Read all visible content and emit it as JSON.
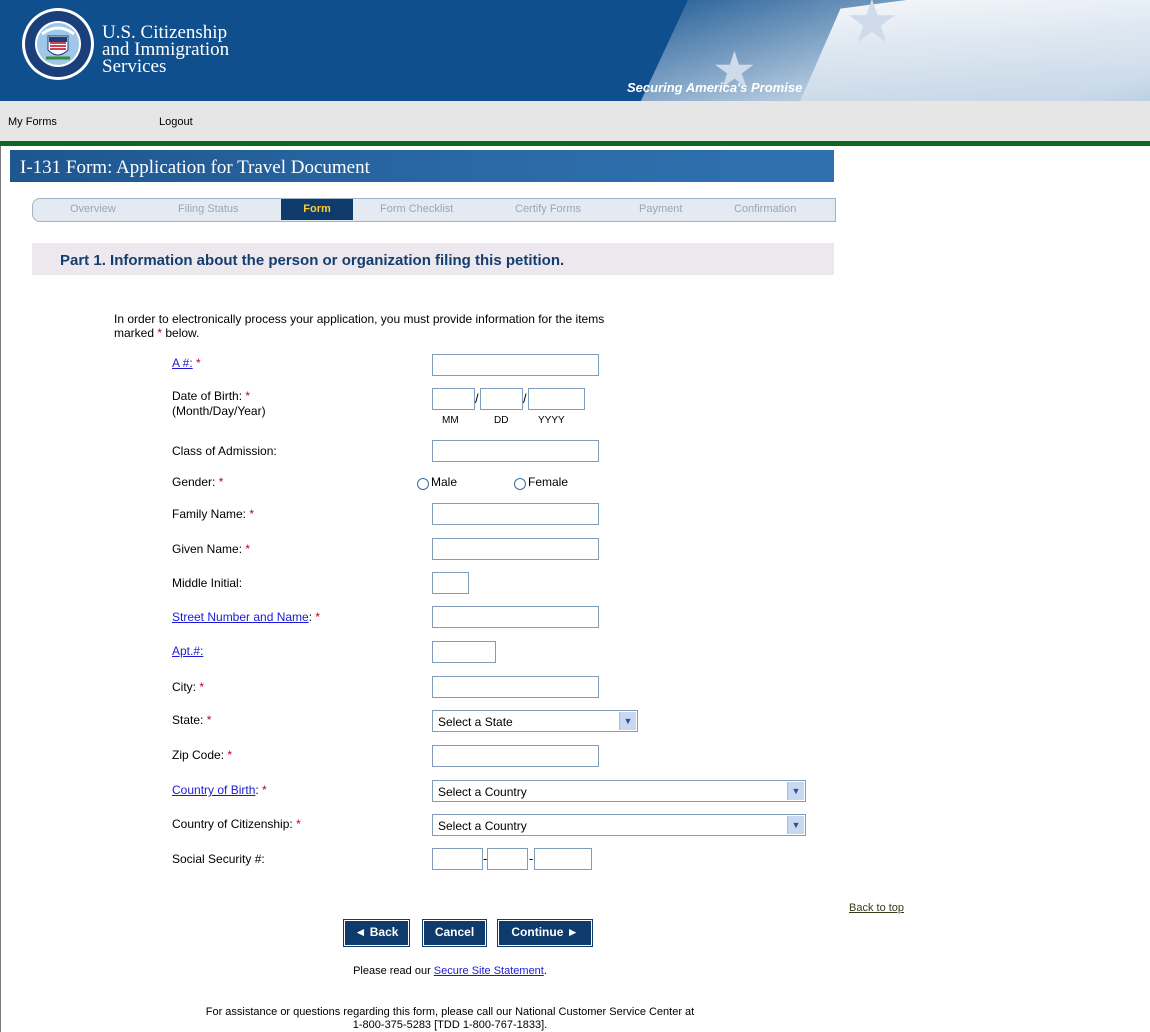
{
  "header": {
    "agency_line1": "U.S. Citizenship",
    "agency_line2": "and Immigration",
    "agency_line3": "Services",
    "tagline": "Securing America's Promise"
  },
  "nav": {
    "my_forms": "My Forms",
    "logout": "Logout"
  },
  "form": {
    "title": "I-131 Form: Application for Travel Document",
    "tabs": [
      "Overview",
      "Filing Status",
      "Form",
      "Form Checklist",
      "Certify Forms",
      "Payment",
      "Confirmation"
    ],
    "active_tab": "Form",
    "part_heading": "Part 1. Information about the person or organization filing this petition.",
    "intro_line1": "In order to electronically process your application, you must provide information for the items",
    "intro_line2_a": "marked ",
    "intro_line2_b": " below.",
    "required_marker": "*",
    "fields": {
      "a_number": "A #:",
      "dob": "Date of Birth:",
      "dob_hint": "(Month/Day/Year)",
      "dob_mm": "MM",
      "dob_dd": "DD",
      "dob_yyyy": "YYYY",
      "class_of_admission": "Class of Admission:",
      "gender": "Gender:",
      "gender_male": "Male",
      "gender_female": "Female",
      "family_name": "Family Name:",
      "given_name": "Given Name:",
      "middle_initial": "Middle Initial:",
      "street": "Street Number and Name",
      "apt": "Apt.#:",
      "city": "City:",
      "state": "State:",
      "state_value": "Select a State",
      "zip": "Zip Code:",
      "country_birth": "Country of Birth",
      "country_birth_value": "Select a Country",
      "country_citizenship": "Country of Citizenship:",
      "country_citizenship_value": "Select a Country",
      "ssn": "Social Security #:"
    }
  },
  "buttons": {
    "back": "◄ Back",
    "cancel": "Cancel",
    "continue": "Continue ►"
  },
  "back_to_top": "Back to top",
  "footer": {
    "secure_prefix": "Please read our ",
    "secure_link": "Secure Site Statement",
    "secure_suffix": ".",
    "assist_line1": "For assistance or questions regarding this form, please call our National Customer Service Center at",
    "assist_line2": "1-800-375-5283 [TDD 1-800-767-1833]."
  }
}
